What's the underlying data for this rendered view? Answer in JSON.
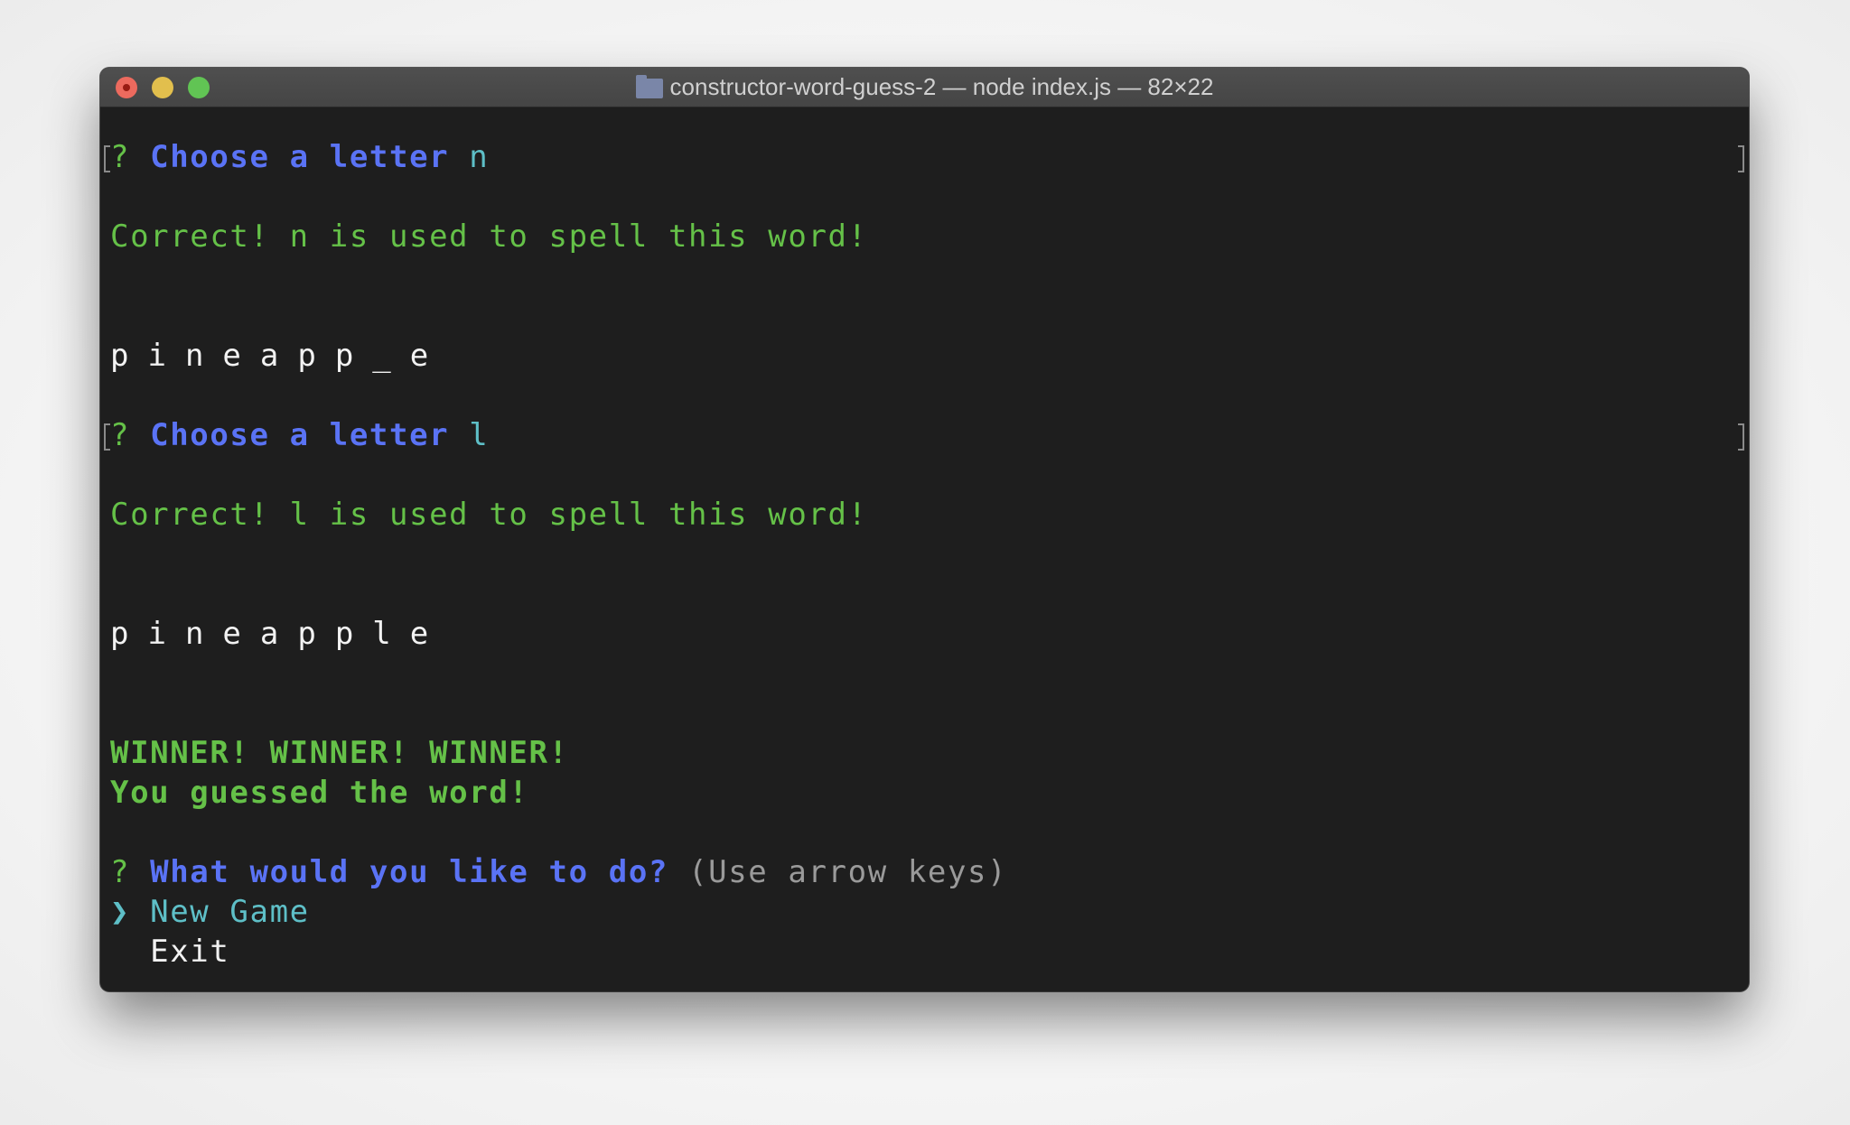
{
  "window": {
    "title": "constructor-word-guess-2 — node index.js — 82×22",
    "controls": [
      "close",
      "minimize",
      "maximize"
    ]
  },
  "terminal": {
    "prompt1": {
      "marker": "?",
      "question": "Choose a letter",
      "answer": "n"
    },
    "result1": "Correct! n is used to spell this word!",
    "word1": "pineapp_e",
    "prompt2": {
      "marker": "?",
      "question": "Choose a letter",
      "answer": "l"
    },
    "result2": "Correct! l is used to spell this word!",
    "word2": "pineapple",
    "winner1": "WINNER! WINNER! WINNER!",
    "winner2": "You guessed the word!",
    "menu": {
      "marker": "?",
      "question": "What would you like to do?",
      "hint": "(Use arrow keys)",
      "pointer": "❯",
      "options": [
        "New Game",
        "Exit"
      ],
      "selected": "New Game"
    }
  },
  "colors": {
    "background": "#1e1e1e",
    "green": "#65c148",
    "blue": "#5a73f5",
    "cyan": "#5ebfc7",
    "gray": "#9a9a9a"
  }
}
